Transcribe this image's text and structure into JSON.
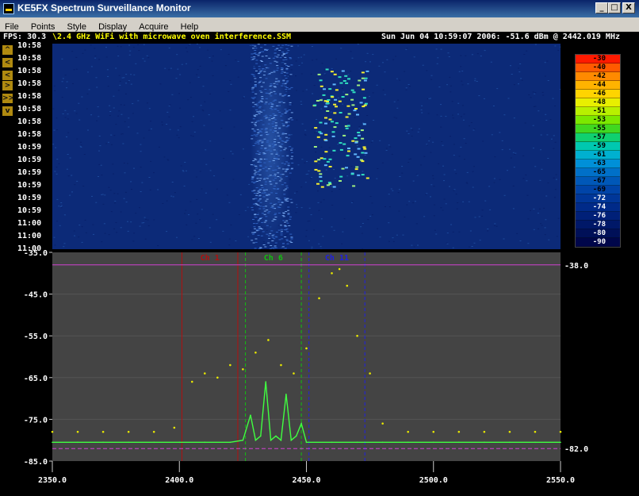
{
  "window": {
    "title": "KE5FX Spectrum Surveillance Monitor"
  },
  "titlebar": {
    "minimize_glyph": "_",
    "maximize_glyph": "□",
    "close_glyph": "X"
  },
  "menu": [
    "File",
    "Points",
    "Style",
    "Display",
    "Acquire",
    "Help"
  ],
  "status": {
    "fps": "FPS: 30.3",
    "file": "\\2.4 GHz WiFi with microwave oven interference.SSM",
    "readout": "Sun Jun 04 10:59:07 2006: -51.6 dBm @ 2442.019 MHz"
  },
  "nav_buttons": [
    "^",
    "<",
    "<",
    ">",
    ">>",
    "v"
  ],
  "waterfall": {
    "time_labels": [
      "10:58",
      "10:58",
      "10:58",
      "10:58",
      "10:58",
      "10:58",
      "10:58",
      "10:58",
      "10:59",
      "10:59",
      "10:59",
      "10:59",
      "10:59",
      "10:59",
      "11:00",
      "11:00",
      "11:00"
    ]
  },
  "colorbar": {
    "labels": [
      "-30",
      "-40",
      "-42",
      "-44",
      "-46",
      "-48",
      "-51",
      "-53",
      "-55",
      "-57",
      "-59",
      "-61",
      "-63",
      "-65",
      "-67",
      "-69",
      "-72",
      "-74",
      "-76",
      "-78",
      "-80",
      "-90"
    ],
    "colors": [
      "#ff1a00",
      "#ff5a00",
      "#ff8a00",
      "#ffb300",
      "#ffd400",
      "#e8ef00",
      "#b8f000",
      "#7ce800",
      "#40d820",
      "#10d070",
      "#00c8b0",
      "#00b0d0",
      "#0090d8",
      "#0070c8",
      "#0058b8",
      "#0044a8",
      "#003698",
      "#002a88",
      "#002078",
      "#001868",
      "#001058",
      "#00064a"
    ]
  },
  "chart_data": {
    "type": "line",
    "xlabel": "",
    "ylabel": "",
    "xlim": [
      2350,
      2550
    ],
    "ylim": [
      -85,
      -35
    ],
    "x_ticks": [
      "2350.0",
      "2400.0",
      "2450.0",
      "2500.0",
      "2550.0"
    ],
    "y_ticks": [
      "-35.0",
      "-45.0",
      "-55.0",
      "-65.0",
      "-75.0",
      "-85.0"
    ],
    "right_labels": {
      "upper": "-38.0",
      "lower": "-82.0"
    },
    "upper_limit": -38,
    "lower_limit": -82,
    "channels": [
      {
        "name": "Ch 1",
        "color": "#b01010",
        "center": 2412,
        "bounds": [
          2401,
          2423
        ],
        "style": "solid"
      },
      {
        "name": "Ch 6",
        "color": "#10c010",
        "center": 2437,
        "bounds": [
          2426,
          2448
        ],
        "style": "dashed"
      },
      {
        "name": "Ch 11",
        "color": "#2020e0",
        "center": 2462,
        "bounds": [
          2451,
          2473
        ],
        "style": "dashed"
      }
    ],
    "series": [
      {
        "name": "",
        "color": "#40ff40",
        "style": "line",
        "x": [
          2350,
          2360,
          2370,
          2380,
          2390,
          2400,
          2410,
          2420,
          2425,
          2428,
          2430,
          2432,
          2434,
          2436,
          2438,
          2440,
          2442,
          2444,
          2446,
          2448,
          2450,
          2460,
          2470,
          2480,
          2490,
          2500,
          2510,
          2520,
          2530,
          2540,
          2550
        ],
        "y": [
          -80.5,
          -80.5,
          -80.5,
          -80.5,
          -80.5,
          -80.5,
          -80.5,
          -80.5,
          -80,
          -74,
          -80,
          -79,
          -66,
          -80,
          -79,
          -80,
          -69,
          -80,
          -79,
          -76,
          -80.5,
          -80.5,
          -80.5,
          -80.5,
          -80.5,
          -80.5,
          -80.5,
          -80.5,
          -80.5,
          -80.5,
          -80.5
        ]
      },
      {
        "name": "",
        "color": "#e8e800",
        "style": "points",
        "x": [
          2350,
          2360,
          2370,
          2380,
          2390,
          2398,
          2405,
          2410,
          2415,
          2420,
          2425,
          2430,
          2435,
          2440,
          2445,
          2450,
          2455,
          2460,
          2463,
          2466,
          2470,
          2475,
          2480,
          2490,
          2500,
          2510,
          2520,
          2530,
          2540,
          2550
        ],
        "y": [
          -78,
          -78,
          -78,
          -78,
          -78,
          -77,
          -66,
          -64,
          -65,
          -62,
          -63,
          -59,
          -56,
          -62,
          -64,
          -58,
          -46,
          -40,
          -39,
          -43,
          -55,
          -64,
          -76,
          -78,
          -78,
          -78,
          -78,
          -78,
          -78,
          -78
        ]
      }
    ]
  }
}
